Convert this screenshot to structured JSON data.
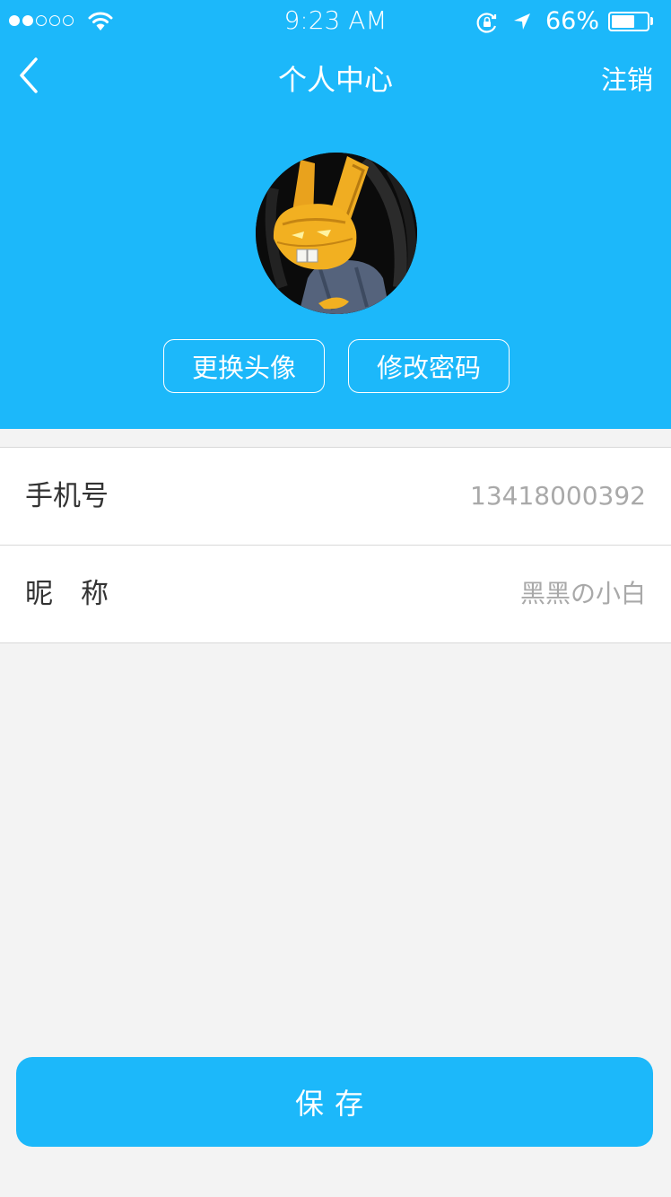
{
  "status_bar": {
    "time": "9:23 AM",
    "battery_percent": "66%",
    "battery_level": 0.66,
    "signal_bars_filled": 2,
    "signal_bars_total": 5
  },
  "nav": {
    "title": "个人中心",
    "logout_label": "注销",
    "back_icon": "chevron-left-icon"
  },
  "profile": {
    "change_avatar_label": "更换头像",
    "change_password_label": "修改密码"
  },
  "fields": [
    {
      "label": "手机号",
      "value": "13418000392"
    },
    {
      "label": "昵　称",
      "value": "黑黑の小白"
    }
  ],
  "save_label": "保存",
  "colors": {
    "primary": "#1cb8fa",
    "background": "#f3f3f3",
    "value_text": "#a9a9a9"
  }
}
